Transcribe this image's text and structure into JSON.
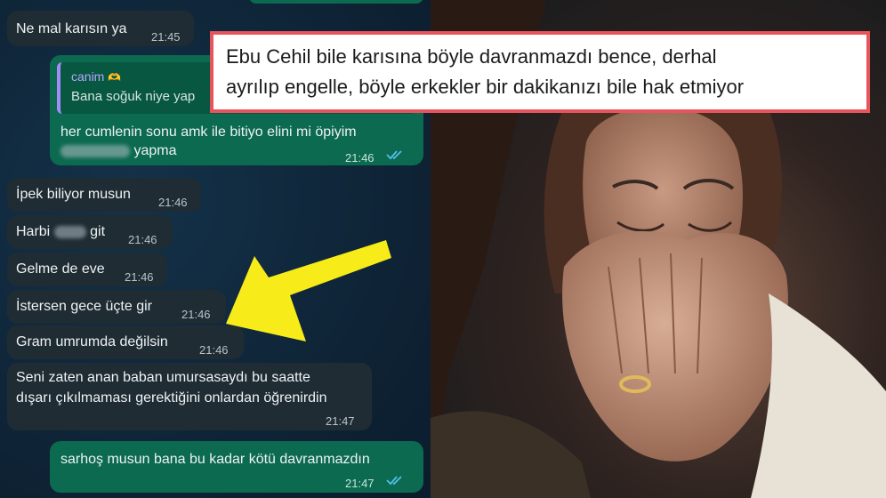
{
  "chat": {
    "messages": [
      {
        "text": "Ne mal karısın ya",
        "time": "21:45"
      },
      {
        "quote_name": "canim",
        "quote_text": "Bana soğuk niye yap",
        "text_line1": "her cumlenin sonu amk ile bitiyo elini mi öpiyim",
        "text_line2": "yapma",
        "time": "21:46"
      },
      {
        "text": "İpek biliyor musun",
        "time": "21:46"
      },
      {
        "text_pre": "Harbi",
        "text_post": "git",
        "time": "21:46"
      },
      {
        "text": "Gelme de eve",
        "time": "21:46"
      },
      {
        "text": "İstersen gece üçte gir",
        "time": "21:46"
      },
      {
        "text": "Gram umrumda değilsin",
        "time": "21:46"
      },
      {
        "text_line1": "Seni zaten anan baban umursasaydı bu saatte",
        "text_line2": "dışarı çıkılmaması gerektiğini onlardan öğrenirdin",
        "time": "21:47"
      },
      {
        "text": "sarhoş musun bana bu kadar kötü davranmazdın",
        "time": "21:47"
      }
    ]
  },
  "caption": {
    "line1": "Ebu Cehil bile karısına böyle davranmazdı bence, derhal",
    "line2": "ayrılıp engelle, böyle erkekler bir dakikanızı bile hak etmiyor"
  },
  "colors": {
    "incoming_bubble": "#1f2c33",
    "outgoing_bubble": "#0b6a4f",
    "read_ticks": "#53bdeb",
    "arrow": "#f7ec1a",
    "caption_border": "#e8545c"
  },
  "icons": [
    "double-check-icon",
    "heart-hands-emoji",
    "arrow-annotation"
  ]
}
